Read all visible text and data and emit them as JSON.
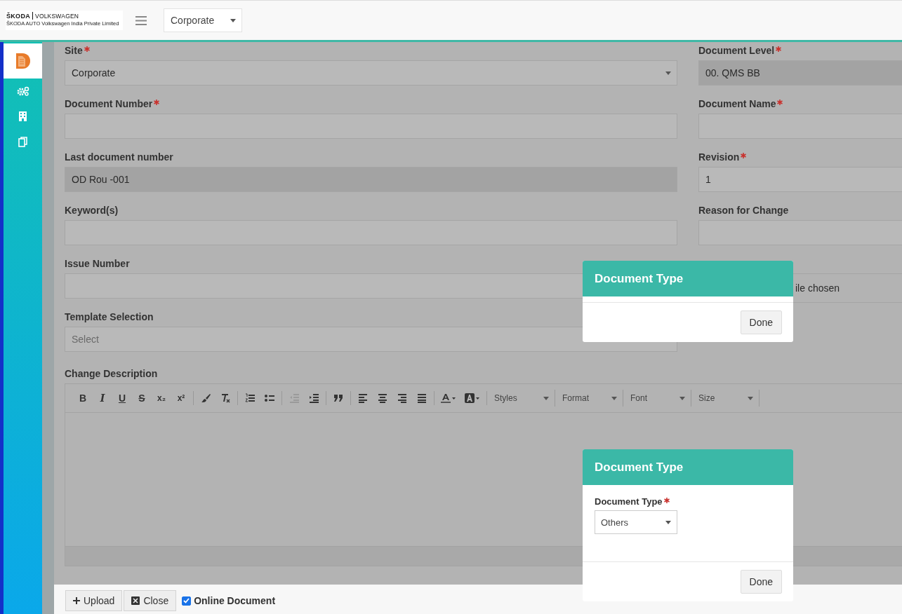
{
  "header": {
    "logo": {
      "brand_left": "ŠKODA",
      "brand_right": "VOLKSWAGEN",
      "company": "ŠKODA AUTO Volkswagen India Private Limited"
    },
    "site_select": {
      "value": "Corporate"
    }
  },
  "sidebar": {
    "items": [
      {
        "selected": true
      },
      {
        "selected": false
      },
      {
        "selected": false
      },
      {
        "selected": false
      }
    ]
  },
  "form": {
    "left": [
      {
        "label": "Site",
        "required": true,
        "kind": "select",
        "value": "Corporate",
        "disabled": false
      },
      {
        "label": "Document Number",
        "required": true,
        "kind": "text",
        "disabled": false
      },
      {
        "label": "Last document number",
        "kind": "text",
        "value": "OD Rou -001",
        "disabled": true
      },
      {
        "label": "Keyword(s)",
        "kind": "text",
        "disabled": false
      },
      {
        "label": "Issue Number",
        "kind": "text",
        "disabled": false
      },
      {
        "label": "Template Selection",
        "kind": "select",
        "placeholder": "Select",
        "disabled": false
      }
    ],
    "right": [
      {
        "label": "Document Level",
        "required": true,
        "kind": "text",
        "value": "00. QMS BB",
        "disabled": true
      },
      {
        "label": "Document Name",
        "required": true,
        "kind": "text",
        "disabled": false
      },
      {
        "label": "Revision",
        "required": true,
        "kind": "text",
        "value": "1",
        "disabled": false
      },
      {
        "label": "Reason for Change",
        "kind": "text",
        "disabled": false
      },
      {
        "kind": "file",
        "value": "ile chosen"
      }
    ]
  },
  "editor": {
    "label": "Change Description",
    "toolbar": [
      [
        {
          "kind": "bold",
          "label": "B",
          "disabled": false
        },
        {
          "kind": "italic",
          "label": "I",
          "disabled": false
        },
        {
          "kind": "underline",
          "label": "U",
          "disabled": false
        },
        {
          "kind": "strike",
          "label": "S",
          "disabled": false
        },
        {
          "kind": "subscript",
          "label": "x₂",
          "disabled": false
        },
        {
          "kind": "superscript",
          "label": "x²",
          "disabled": false
        }
      ],
      [
        {
          "kind": "brush",
          "disabled": false
        },
        {
          "kind": "clear",
          "disabled": false
        }
      ],
      [
        {
          "kind": "ol",
          "disabled": false
        },
        {
          "kind": "ul",
          "disabled": false
        }
      ],
      [
        {
          "kind": "outdent",
          "disabled": true
        },
        {
          "kind": "indent",
          "disabled": false
        }
      ],
      [
        {
          "kind": "quote",
          "disabled": false
        }
      ],
      [
        {
          "kind": "align-left",
          "disabled": false
        },
        {
          "kind": "align-center",
          "disabled": false
        },
        {
          "kind": "align-right",
          "disabled": false
        },
        {
          "kind": "justify",
          "disabled": false
        }
      ],
      [
        {
          "kind": "text-color",
          "disabled": false
        },
        {
          "kind": "bg-color",
          "disabled": false
        }
      ]
    ],
    "dropdowns": [
      "Styles",
      "Format",
      "Font",
      "Size"
    ]
  },
  "footer": {
    "buttons": [
      {
        "kind": "upload",
        "label": "Upload"
      },
      {
        "kind": "close",
        "label": "Close"
      }
    ],
    "online_document": {
      "label": "Online Document",
      "checked": true
    }
  },
  "dialogs": [
    {
      "title": "Document Type",
      "button": "Done"
    },
    {
      "title": "Document Type",
      "fields": [
        {
          "label": "Document Type",
          "required": true,
          "value": "Others"
        }
      ],
      "button": "Done"
    }
  ]
}
